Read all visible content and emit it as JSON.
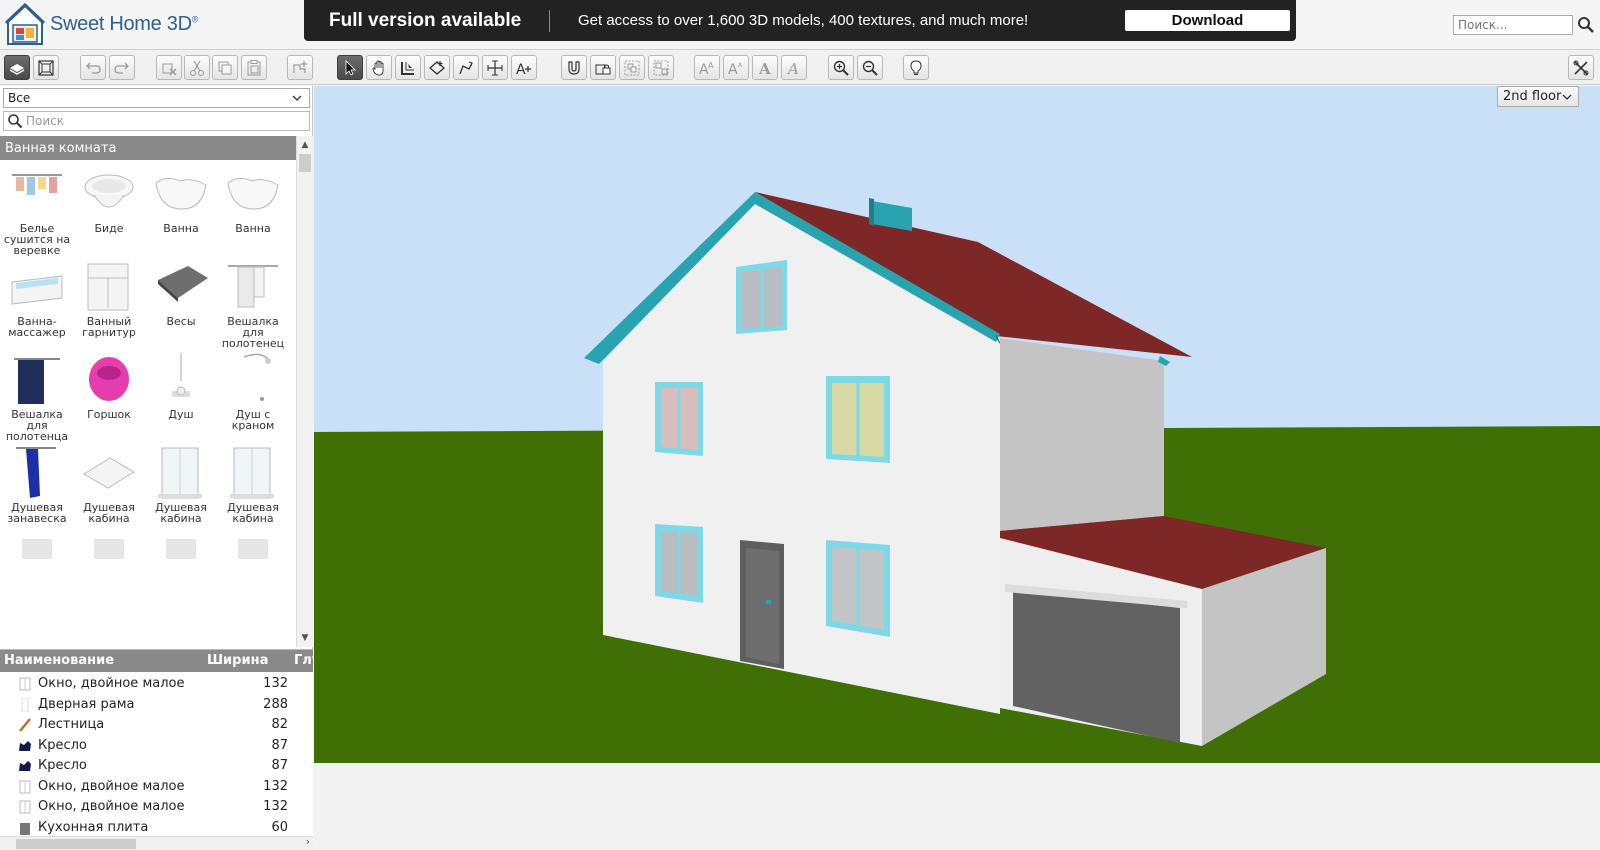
{
  "app": {
    "name": "Sweet Home 3D",
    "trademark": "®"
  },
  "banner": {
    "title": "Full version available",
    "text": "Get access to over 1,600 3D models, 400 textures, and much more!",
    "button": "Download"
  },
  "top_search": {
    "placeholder": "Поиск..."
  },
  "catalog": {
    "filter_selected": "Все",
    "search_placeholder": "Поиск",
    "category": "Ванная комната",
    "items": [
      {
        "label": "Белье сушится на веревке",
        "icon": "clothesline-icon"
      },
      {
        "label": "Биде",
        "icon": "bidet-icon"
      },
      {
        "label": "Ванна",
        "icon": "bathtub-icon"
      },
      {
        "label": "Ванна",
        "icon": "bathtub-icon"
      },
      {
        "label": "Ванна-массажер",
        "icon": "jacuzzi-icon"
      },
      {
        "label": "Ванный гарнитур",
        "icon": "bathroom-cabinet-icon"
      },
      {
        "label": "Весы",
        "icon": "scale-icon"
      },
      {
        "label": "Вешалка для полотенец",
        "icon": "towel-rack-icon"
      },
      {
        "label": "Вешалка для полотенца",
        "icon": "towel-hanger-icon"
      },
      {
        "label": "Горшок",
        "icon": "potty-icon"
      },
      {
        "label": "Душ",
        "icon": "shower-icon"
      },
      {
        "label": "Душ с краном",
        "icon": "shower-tap-icon"
      },
      {
        "label": "Душевая занавеска",
        "icon": "shower-curtain-icon"
      },
      {
        "label": "Душевая кабина",
        "icon": "shower-tray-icon"
      },
      {
        "label": "Душевая кабина",
        "icon": "shower-cabin-icon"
      },
      {
        "label": "Душевая кабина",
        "icon": "shower-cabin-icon"
      }
    ]
  },
  "furniture_table": {
    "columns": [
      "Наименование",
      "Ширина",
      "Глу"
    ],
    "rows": [
      {
        "name": "Окно, двойное малое",
        "width": "132",
        "icon": "window-icon"
      },
      {
        "name": "Дверная рама",
        "width": "288",
        "icon": "door-frame-icon"
      },
      {
        "name": "Лестница",
        "width": "82",
        "icon": "stairs-icon"
      },
      {
        "name": "Кресло",
        "width": "87",
        "icon": "armchair-icon"
      },
      {
        "name": "Кресло",
        "width": "87",
        "icon": "armchair-icon"
      },
      {
        "name": "Окно, двойное малое",
        "width": "132",
        "icon": "window-icon"
      },
      {
        "name": "Окно, двойное малое",
        "width": "132",
        "icon": "window-icon"
      },
      {
        "name": "Кухонная плита",
        "width": "60",
        "icon": "stove-icon"
      }
    ]
  },
  "view3d": {
    "level": "2nd floor",
    "colors": {
      "sky": "#c9e0f6",
      "ground": "#3f6f05",
      "roof": "#7d2826",
      "trim": "#2aa3b0",
      "wall": "#f0f0f0",
      "window_frame": "#7fd8e6",
      "garage_door": "#626262"
    }
  }
}
